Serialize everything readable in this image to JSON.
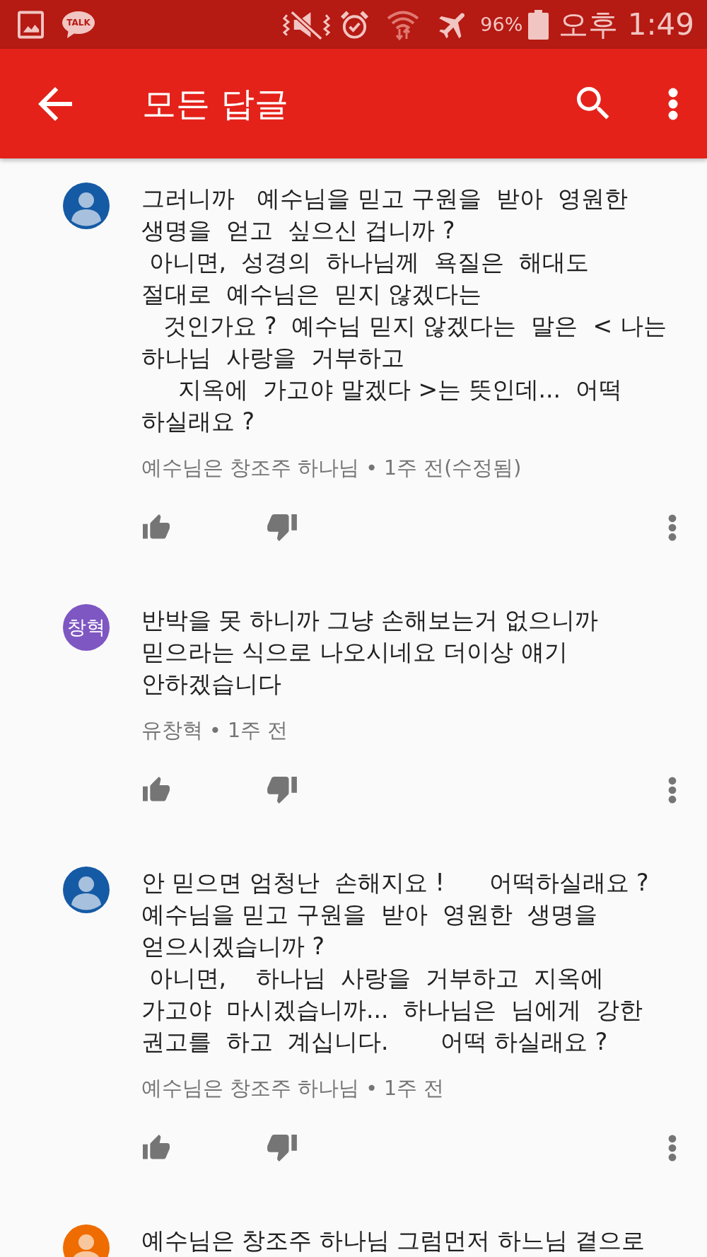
{
  "status_bar": {
    "chat_badge": "TALK",
    "battery": "96%",
    "time": "오후 1:49"
  },
  "app_bar": {
    "title": "모든 답글"
  },
  "comments": [
    {
      "avatar": {
        "kind": "silhouette",
        "color": "#155aa5"
      },
      "text": "그러니까   예수님을 믿고 구원을  받아  영원한\n생명을  얻고  싶으신 겁니까 ?\n 아니면,  성경의  하나님께  욕질은  해대도\n절대로  예수님은  믿지 않겠다는\n   것인가요 ?  예수님 믿지 않겠다는  말은  < 나는\n하나님  사랑을  거부하고\n     지옥에  가고야 말겠다 >는 뜻인데...  어떡\n하실래요 ?",
      "meta": "예수님은 창조주 하나님 • 1주 전(수정됨)"
    },
    {
      "avatar": {
        "kind": "initials",
        "initials": "창혁",
        "color": "#7e57c2"
      },
      "text": "반박을 못 하니까 그냥 손해보는거 없으니까\n믿으라는 식으로 나오시네요 더이상 얘기\n안하겠습니다",
      "meta": "유창혁 • 1주 전"
    },
    {
      "avatar": {
        "kind": "silhouette",
        "color": "#155aa5"
      },
      "text": "안 믿으면 엄청난  손해지요 !      어떡하실래요 ?\n예수님을 믿고 구원을  받아  영원한  생명을\n얻으시겠습니까 ?\n 아니면,    하나님  사랑을  거부하고  지옥에\n가고야  마시겠습니까...  하나님은  님에게  강한\n권고를  하고  계십니다.       어떡 하실래요 ?",
      "meta": "예수님은 창조주 하나님 • 1주 전"
    },
    {
      "avatar": {
        "kind": "silhouette",
        "color": "#ef6c00"
      },
      "text": "예수님은 창조주 하나님 그럼먼저 하느님 곁으로"
    }
  ]
}
